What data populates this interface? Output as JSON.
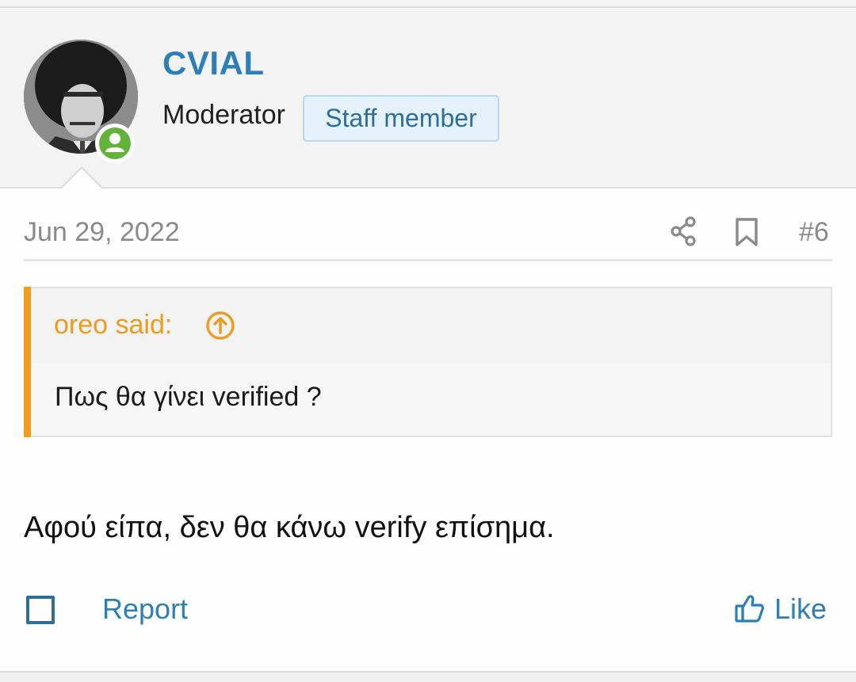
{
  "post": {
    "author": {
      "username": "CVIAL",
      "title": "Moderator",
      "staff_badge": "Staff member",
      "online": true,
      "avatar_icon": "user-avatar-photo",
      "online_icon": "user-online-icon"
    },
    "meta": {
      "date": "Jun 29, 2022",
      "post_number": "#6",
      "share_icon": "share-icon",
      "bookmark_icon": "bookmark-icon"
    },
    "quote": {
      "author_label": "oreo said:",
      "jump_icon": "arrow-up-circle-icon",
      "text": "Πως θα γίνει verified ?"
    },
    "body": "Αφού είπα, δεν θα κάνω verify επίσημα.",
    "footer": {
      "report_label": "Report",
      "like_label": "Like",
      "like_icon": "thumbs-up-icon"
    }
  },
  "colors": {
    "link": "#2d7fb6",
    "quote_accent": "#f29d1f",
    "online": "#63b33a",
    "badge_bg": "#e6f2fb",
    "badge_border": "#b7daf0",
    "muted_text": "#8a8a8a"
  }
}
